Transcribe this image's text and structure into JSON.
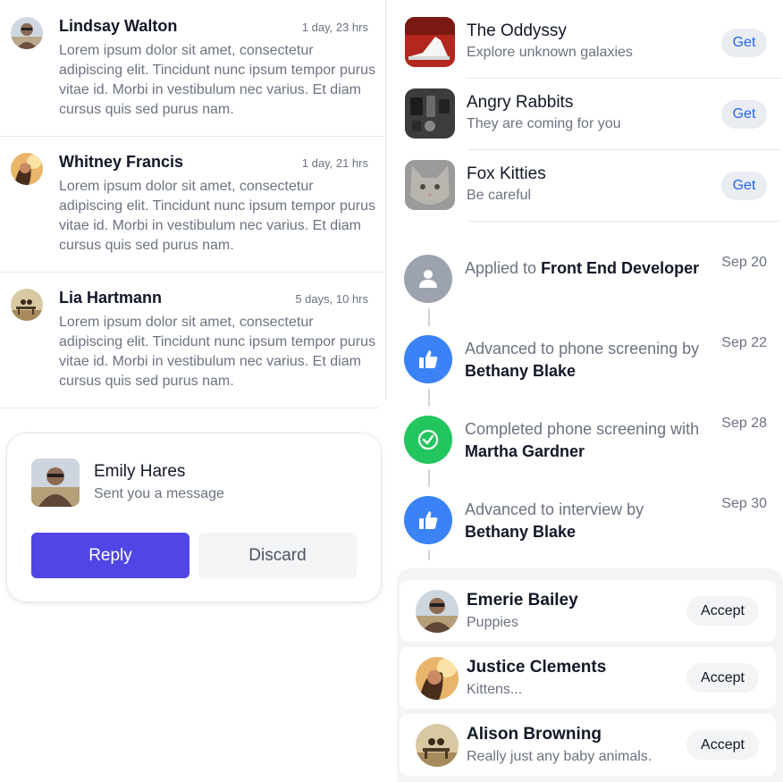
{
  "messages": [
    {
      "name": "Lindsay Walton",
      "time": "1 day, 23 hrs",
      "body": "Lorem ipsum dolor sit amet, consectetur adipiscing elit. Tincidunt nunc ipsum tempor purus vitae id. Morbi in vestibulum nec varius. Et diam cursus quis sed purus nam."
    },
    {
      "name": "Whitney Francis",
      "time": "1 day, 21 hrs",
      "body": "Lorem ipsum dolor sit amet, consectetur adipiscing elit. Tincidunt nunc ipsum tempor purus vitae id. Morbi in vestibulum nec varius. Et diam cursus quis sed purus nam."
    },
    {
      "name": "Lia Hartmann",
      "time": "5 days, 10 hrs",
      "body": "Lorem ipsum dolor sit amet, consectetur adipiscing elit. Tincidunt nunc ipsum tempor purus vitae id. Morbi in vestibulum nec varius. Et diam cursus quis sed purus nam."
    }
  ],
  "notification": {
    "name": "Emily Hares",
    "subtitle": "Sent you a message",
    "reply_label": "Reply",
    "discard_label": "Discard",
    "reply_color": "#4f46e5"
  },
  "apps": [
    {
      "name": "The Oddyssy",
      "desc": "Explore unknown galaxies",
      "button": "Get",
      "icon": "shoe-image"
    },
    {
      "name": "Angry Rabbits",
      "desc": "They are coming for you",
      "button": "Get",
      "icon": "gadgets-image"
    },
    {
      "name": "Fox Kitties",
      "desc": "Be careful",
      "button": "Get",
      "icon": "kitten-image"
    }
  ],
  "timeline": [
    {
      "prefix": "Applied to ",
      "target": "Front End Developer",
      "date": "Sep 20",
      "icon": "user-icon",
      "color": "#9ca3af"
    },
    {
      "prefix": "Advanced to phone screening by ",
      "target": "Bethany Blake",
      "date": "Sep 22",
      "icon": "thumbs-up-icon",
      "color": "#3b82f6"
    },
    {
      "prefix": "Completed phone screening with ",
      "target": "Martha Gardner",
      "date": "Sep 28",
      "icon": "check-icon",
      "color": "#22c55e"
    },
    {
      "prefix": "Advanced to interview by ",
      "target": "Bethany Blake",
      "date": "Sep 30",
      "icon": "thumbs-up-icon",
      "color": "#3b82f6"
    }
  ],
  "requests": [
    {
      "name": "Emerie Bailey",
      "sub": "Puppies",
      "button": "Accept"
    },
    {
      "name": "Justice Clements",
      "sub": "Kittens...",
      "button": "Accept"
    },
    {
      "name": "Alison Browning",
      "sub": "Really just any baby animals.",
      "button": "Accept"
    }
  ]
}
